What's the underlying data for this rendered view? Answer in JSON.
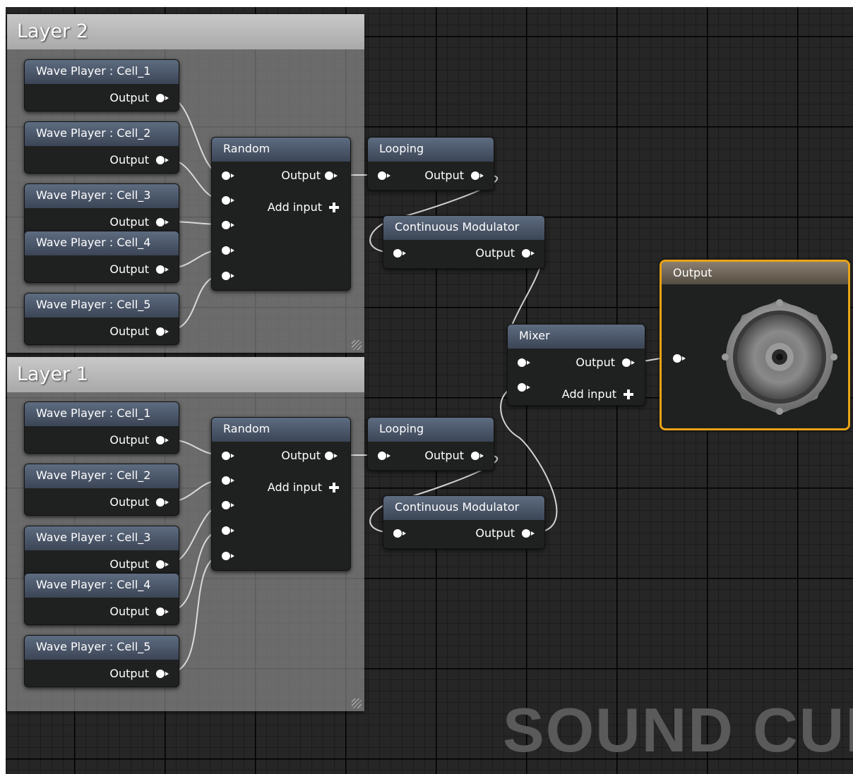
{
  "editor": {
    "watermark": "SOUND CUE",
    "colors": {
      "graph_background": "#262626",
      "wire": "#e8e8e8",
      "selected_outline": "#e8a317",
      "comment_box": "#9a9a9a"
    }
  },
  "layer2": {
    "title": "Layer 2",
    "wave_players": [
      {
        "title": "Wave Player : Cell_1",
        "output": "Output"
      },
      {
        "title": "Wave Player : Cell_2",
        "output": "Output"
      },
      {
        "title": "Wave Player : Cell_3",
        "output": "Output"
      },
      {
        "title": "Wave Player : Cell_4",
        "output": "Output"
      },
      {
        "title": "Wave Player : Cell_5",
        "output": "Output"
      }
    ],
    "random": {
      "title": "Random",
      "output": "Output",
      "add_input": "Add input"
    },
    "looping": {
      "title": "Looping",
      "output": "Output"
    },
    "modulator": {
      "title": "Continuous Modulator",
      "output": "Output"
    }
  },
  "layer1": {
    "title": "Layer 1",
    "wave_players": [
      {
        "title": "Wave Player : Cell_1",
        "output": "Output"
      },
      {
        "title": "Wave Player : Cell_2",
        "output": "Output"
      },
      {
        "title": "Wave Player : Cell_3",
        "output": "Output"
      },
      {
        "title": "Wave Player : Cell_4",
        "output": "Output"
      },
      {
        "title": "Wave Player : Cell_5",
        "output": "Output"
      }
    ],
    "random": {
      "title": "Random",
      "output": "Output",
      "add_input": "Add input"
    },
    "looping": {
      "title": "Looping",
      "output": "Output"
    },
    "modulator": {
      "title": "Continuous Modulator",
      "output": "Output"
    }
  },
  "mixer": {
    "title": "Mixer",
    "output": "Output",
    "add_input": "Add input"
  },
  "output_node": {
    "title": "Output",
    "icon": "speaker-icon"
  }
}
